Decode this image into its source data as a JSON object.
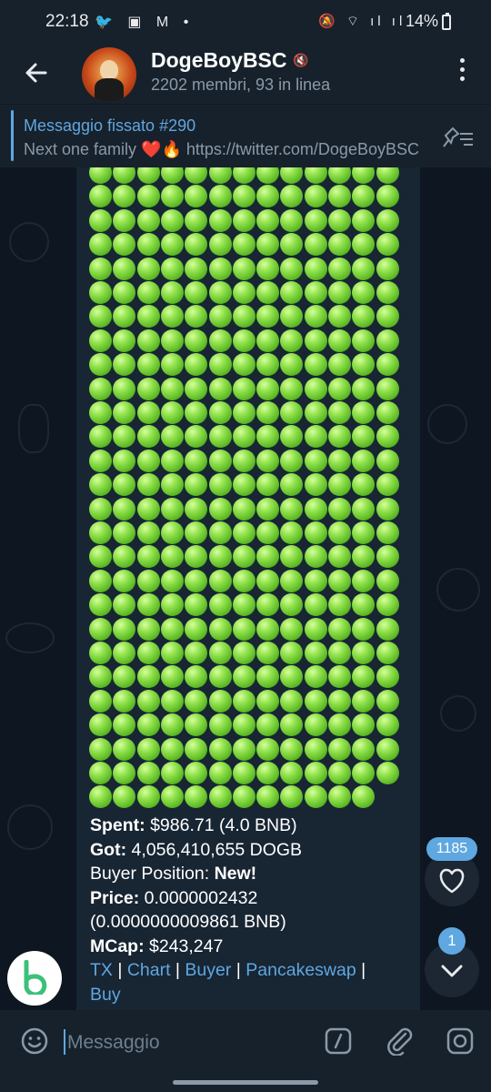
{
  "status_bar": {
    "time": "22:18",
    "left_icons": "🐦 ▣ M •",
    "right_icons": "🔕 ⌔ ıl ıl",
    "battery": "14%"
  },
  "header": {
    "title": "DogeBoyBSC",
    "subtitle": "2202 membri, 93 in linea",
    "muted_icon": "🔇"
  },
  "pinned": {
    "title": "Messaggio fissato #290",
    "text": "Next one family ❤️🔥 https://twitter.com/DogeBoyBSC"
  },
  "message": {
    "spent_label": "Spent:",
    "spent_value": " $986.71 (4.0 BNB)",
    "got_label": "Got:",
    "got_value": " 4,056,410,655 DOGB",
    "position_label": "Buyer Position: ",
    "position_value": "New!",
    "price_label": "Price:",
    "price_value": " 0.0000002432",
    "price_bnb": "(0.0000000009861 BNB)",
    "mcap_label": "MCap:",
    "mcap_value": " $243,247",
    "links": {
      "tx": "TX",
      "chart": "Chart",
      "buyer": "Buyer",
      "pancakeswap": "Pancakeswap",
      "buy": "Buy"
    },
    "sep": " | "
  },
  "reaction": {
    "count": "1185",
    "icon": "heart-icon"
  },
  "scroll_down": {
    "unread": "1"
  },
  "input": {
    "placeholder": "Messaggio"
  },
  "colors": {
    "accent": "#5fa7e0",
    "background": "#0e1621",
    "bubble": "#182533",
    "bar": "#17212b",
    "ball": "#8ee04a"
  }
}
